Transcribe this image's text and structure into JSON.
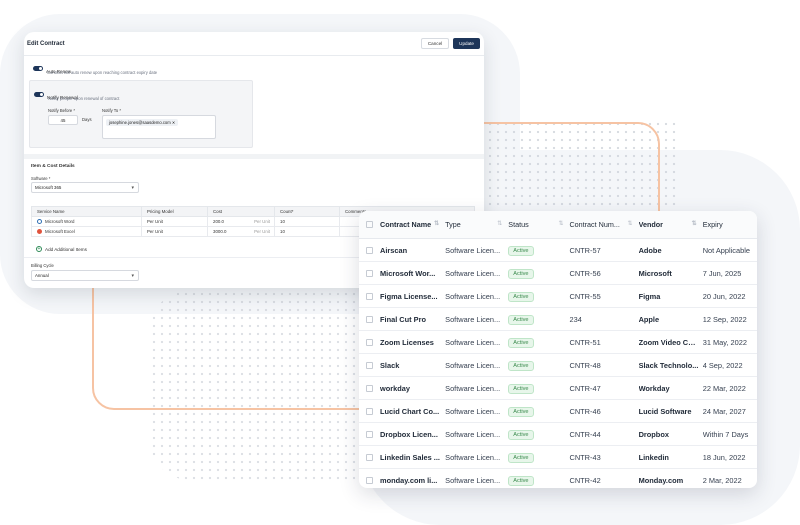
{
  "edit_contract": {
    "title": "Edit Contract",
    "cancel_label": "Cancel",
    "update_label": "Update",
    "auto_renew": {
      "label": "Auto Renew",
      "description": "Contract will auto renew upon reaching contract expiry date"
    },
    "notify_renewal": {
      "label": "Notify Renewal",
      "description": "Notify people upon renewal of contract",
      "notify_before_label": "Notify Before *",
      "notify_before_value": "45",
      "days_label": "Days",
      "notify_to_label": "Notify To *",
      "notify_to_chip": "josephine.jones@saasdemo.com"
    },
    "items": {
      "section_title": "Item & Cost Details",
      "software_label": "Software *",
      "software_value": "Microsoft 365",
      "columns": [
        "Service Name",
        "Pricing Model",
        "Cost",
        "Count*",
        "Comments"
      ],
      "rows": [
        {
          "name": "Microsoft Word",
          "pricing": "Per Unit",
          "cost": "200.0",
          "unit": "Per Unit",
          "count": "10"
        },
        {
          "name": "Microsoft Excel",
          "pricing": "Per Unit",
          "cost": "3000.0",
          "unit": "Per Unit",
          "count": "10"
        }
      ],
      "add_label": "Add Additional Items",
      "billing_label": "Billing Cycle",
      "billing_value": "Annual"
    }
  },
  "contracts_table": {
    "columns": [
      "Contract Name",
      "Type",
      "Status",
      "Contract Num...",
      "Vendor",
      "Expiry"
    ],
    "rows": [
      {
        "name": "Airscan",
        "type": "Software Licen...",
        "status": "Active",
        "num": "CNTR-57",
        "vendor": "Adobe",
        "expiry": "Not Applicable"
      },
      {
        "name": "Microsoft Wor...",
        "type": "Software Licen...",
        "status": "Active",
        "num": "CNTR-56",
        "vendor": "Microsoft",
        "expiry": "7 Jun, 2025"
      },
      {
        "name": "Figma License...",
        "type": "Software Licen...",
        "status": "Active",
        "num": "CNTR-55",
        "vendor": "Figma",
        "expiry": "20 Jun, 2022"
      },
      {
        "name": "Final Cut Pro",
        "type": "Software Licen...",
        "status": "Active",
        "num": "234",
        "vendor": "Apple",
        "expiry": "12 Sep, 2022"
      },
      {
        "name": "Zoom Licenses",
        "type": "Software Licen...",
        "status": "Active",
        "num": "CNTR-51",
        "vendor": "Zoom Video Co...",
        "expiry": "31 May, 2022"
      },
      {
        "name": "Slack",
        "type": "Software Licen...",
        "status": "Active",
        "num": "CNTR-48",
        "vendor": "Slack Technolo...",
        "expiry": "4 Sep, 2022"
      },
      {
        "name": "workday",
        "type": "Software Licen...",
        "status": "Active",
        "num": "CNTR-47",
        "vendor": "Workday",
        "expiry": "22 Mar, 2022"
      },
      {
        "name": "Lucid Chart Co...",
        "type": "Software Licen...",
        "status": "Active",
        "num": "CNTR-46",
        "vendor": "Lucid Software",
        "expiry": "24 Mar, 2027"
      },
      {
        "name": "Dropbox Licen...",
        "type": "Software Licen...",
        "status": "Active",
        "num": "CNTR-44",
        "vendor": "Dropbox",
        "expiry": "Within 7 Days"
      },
      {
        "name": "Linkedin Sales ...",
        "type": "Software Licen...",
        "status": "Active",
        "num": "CNTR-43",
        "vendor": "Linkedin",
        "expiry": "18 Jun, 2022"
      },
      {
        "name": "monday.com li...",
        "type": "Software Licen...",
        "status": "Active",
        "num": "CNTR-42",
        "vendor": "Monday.com",
        "expiry": "2 Mar, 2022"
      }
    ]
  },
  "colors": {
    "primary": "#1d3559",
    "accent_orange": "#f6c3a3",
    "active_green": "#3a8a4d"
  }
}
